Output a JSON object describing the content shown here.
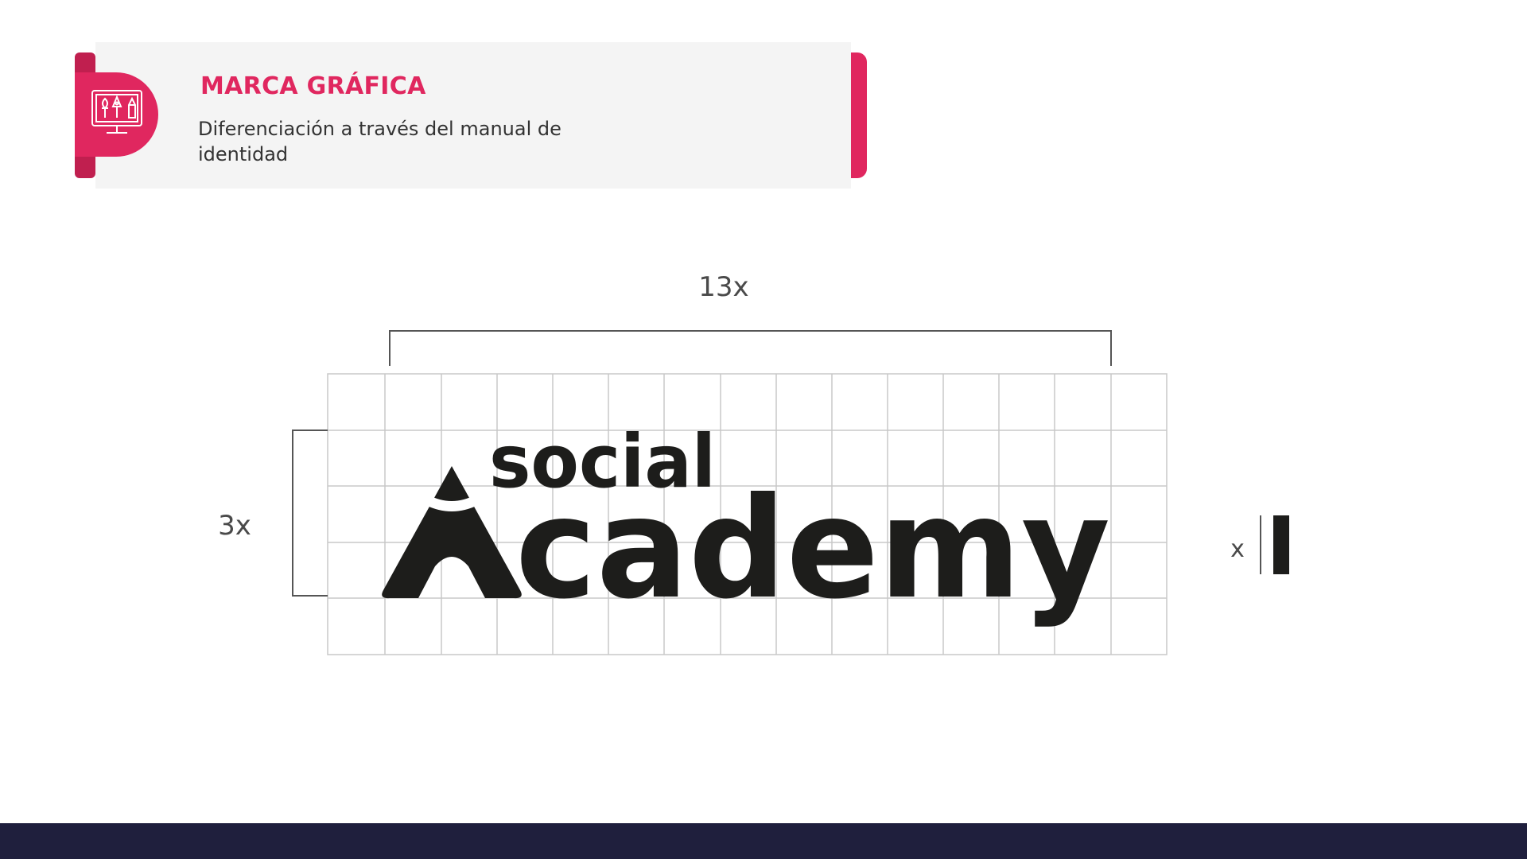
{
  "header": {
    "title": "MARCA GRÁFICA",
    "subtitle": "Diferenciación a través del manual de identidad",
    "icon": "design-tools-monitor-icon"
  },
  "logo": {
    "line1": "social",
    "line2_rest": "cademy"
  },
  "dimensions": {
    "width_label": "13x",
    "height_label": "3x",
    "unit_label": "x"
  },
  "colors": {
    "accent": "#e0275f",
    "accent_dark": "#c01f4f",
    "logo": "#1d1d1b",
    "footer": "#1f1f3d",
    "header_bg": "#f4f4f4"
  }
}
